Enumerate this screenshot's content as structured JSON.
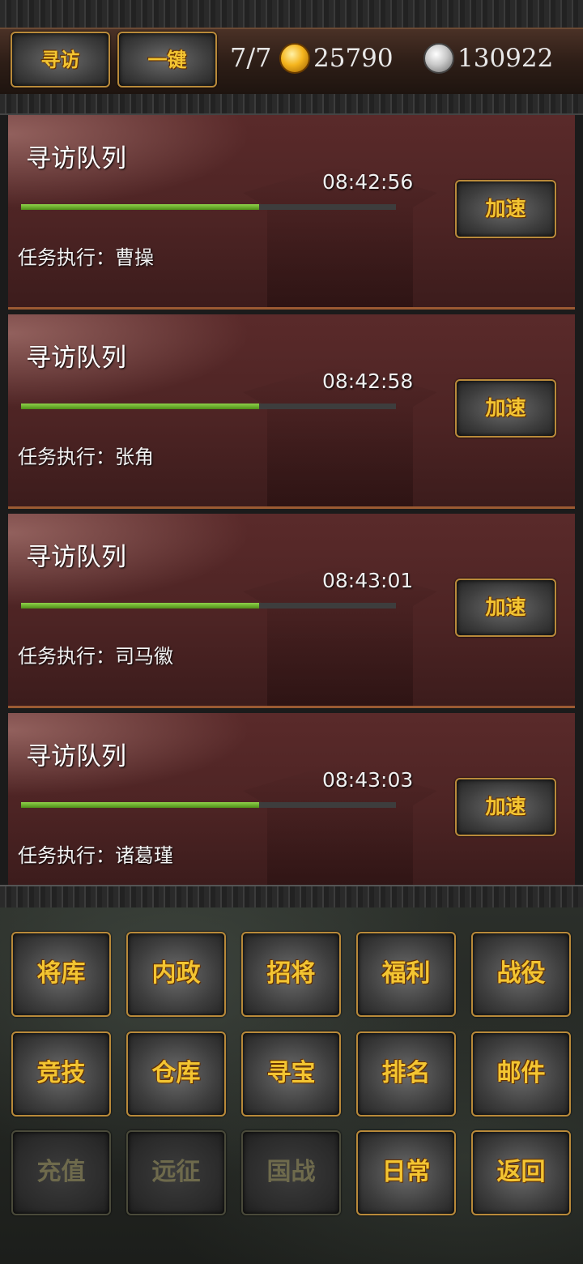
{
  "header": {
    "visit_button": "寻访",
    "onekey_button": "一键",
    "count": "7/7",
    "gold": "25790",
    "silver": "130922",
    "gold_icon": "gold-ingot-icon",
    "silver_icon": "silver-ingot-icon"
  },
  "queues": [
    {
      "title": "寻访队列",
      "timer": "08:42:56",
      "progress": 0.635,
      "executor": "任务执行：曹操",
      "speed_label": "加速"
    },
    {
      "title": "寻访队列",
      "timer": "08:42:58",
      "progress": 0.635,
      "executor": "任务执行：张角",
      "speed_label": "加速"
    },
    {
      "title": "寻访队列",
      "timer": "08:43:01",
      "progress": 0.635,
      "executor": "任务执行：司马徽",
      "speed_label": "加速"
    },
    {
      "title": "寻访队列",
      "timer": "08:43:03",
      "progress": 0.635,
      "executor": "任务执行：诸葛瑾",
      "speed_label": "加速"
    }
  ],
  "menu": [
    {
      "label": "将库",
      "enabled": true
    },
    {
      "label": "内政",
      "enabled": true
    },
    {
      "label": "招将",
      "enabled": true
    },
    {
      "label": "福利",
      "enabled": true
    },
    {
      "label": "战役",
      "enabled": true
    },
    {
      "label": "竞技",
      "enabled": true
    },
    {
      "label": "仓库",
      "enabled": true
    },
    {
      "label": "寻宝",
      "enabled": true
    },
    {
      "label": "排名",
      "enabled": true
    },
    {
      "label": "邮件",
      "enabled": true
    },
    {
      "label": "充值",
      "enabled": false
    },
    {
      "label": "远征",
      "enabled": false
    },
    {
      "label": "国战",
      "enabled": false
    },
    {
      "label": "日常",
      "enabled": true
    },
    {
      "label": "返回",
      "enabled": true
    }
  ],
  "colors": {
    "button_text": "#f3c532",
    "button_border": "#b98a3a",
    "card_bg": "#4d2424",
    "progress_fill": "#6db82e"
  }
}
